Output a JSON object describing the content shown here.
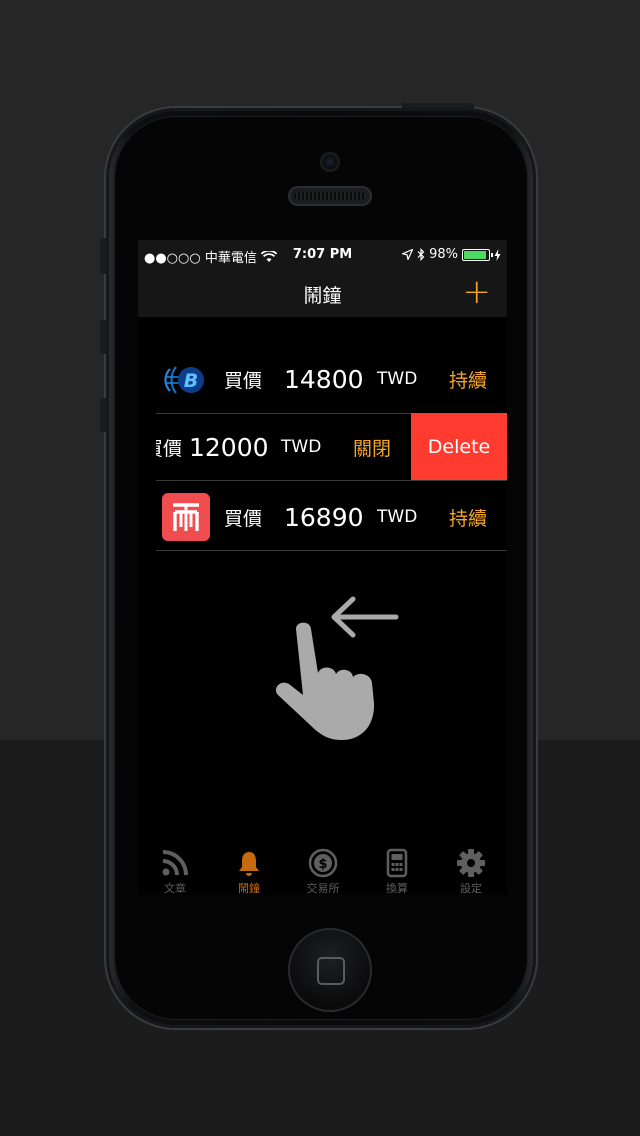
{
  "statusbar": {
    "carrier": "●●○○○ 中華電信",
    "time": "7:07 PM",
    "battery": "98%"
  },
  "navbar": {
    "title": "鬧鐘",
    "add_label": "+"
  },
  "alarms": [
    {
      "exchange_icon": "bitoex-logo-icon",
      "label": "買價",
      "price": "14800",
      "currency": "TWD",
      "status": "持續"
    },
    {
      "exchange_icon": "hidden",
      "label": "買價",
      "price": "12000",
      "currency": "TWD",
      "status": "關閉",
      "delete_label": "Delete"
    },
    {
      "exchange_icon": "coin-logo-icon",
      "label": "買價",
      "price": "16890",
      "currency": "TWD",
      "status": "持續"
    }
  ],
  "tabs": [
    {
      "label": "文章",
      "icon": "rss-icon"
    },
    {
      "label": "鬧鐘",
      "icon": "bell-icon",
      "active": true
    },
    {
      "label": "交易所",
      "icon": "dollar-coin-icon"
    },
    {
      "label": "換算",
      "icon": "calculator-icon"
    },
    {
      "label": "設定",
      "icon": "gear-icon"
    }
  ],
  "colors": {
    "accent": "#f5a623",
    "active_tab": "#c56a10",
    "delete": "#ff3b30",
    "battery": "#4cd964"
  }
}
